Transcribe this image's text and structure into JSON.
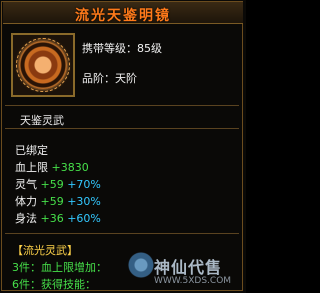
{
  "item": {
    "name": "流光天鉴明镜",
    "carry_level": "携带等级：85级",
    "grade": "品阶：天阶",
    "icon": "bronze-mirror-icon"
  },
  "section": {
    "label": "天鉴灵武"
  },
  "bound": "已绑定",
  "attributes": [
    {
      "name": "血上限",
      "value": "+3830",
      "percent": ""
    },
    {
      "name": "灵气",
      "value": "+59",
      "percent": "+70%"
    },
    {
      "name": "体力",
      "value": "+59",
      "percent": "+30%"
    },
    {
      "name": "身法",
      "value": "+36",
      "percent": "+60%"
    }
  ],
  "set": {
    "title": "【流光灵武】",
    "bonus_3": "3件：血上限增加：",
    "bonus_6": "6件：获得技能："
  },
  "watermark": {
    "text": "神仙代售",
    "url": "WWW.5XDS.COM"
  },
  "colors": {
    "title": "#ff7a1a",
    "green": "#46e04a",
    "cyan": "#33c8ff",
    "set_title": "#ffd34a"
  }
}
